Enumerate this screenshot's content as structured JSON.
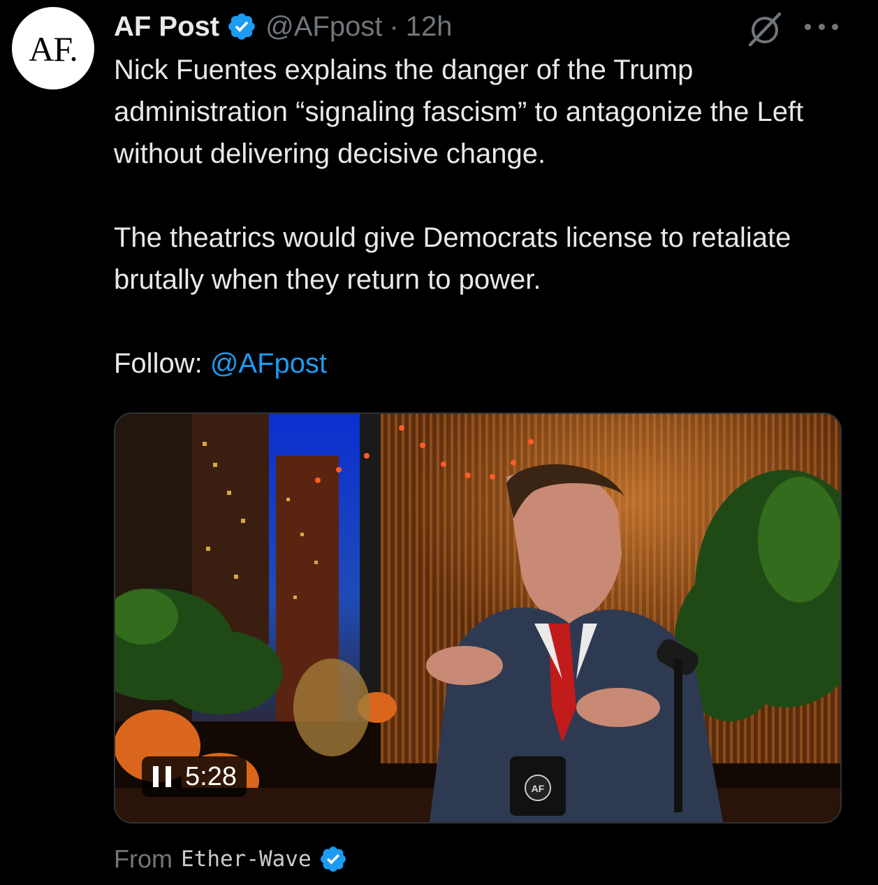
{
  "post": {
    "avatar_text": "AF.",
    "author_name": "AF Post",
    "handle": "@AFpost",
    "separator": "·",
    "time_ago": "12h",
    "paragraph_1": "Nick Fuentes explains the danger of the Trump administration “signaling fascism” to antagonize the Left without delivering decisive change.",
    "paragraph_2": "The theatrics would give Democrats license to retaliate brutally when they return to power.",
    "follow_label": "Follow: ",
    "follow_mention": "@AFpost"
  },
  "video": {
    "duration": "5:28",
    "state_icon": "pause-icon",
    "mug_logo": "AF"
  },
  "source": {
    "prefix": "From",
    "name": "Ether-Wave"
  },
  "icons": {
    "verified": "verified-badge-icon",
    "grok": "grok-icon",
    "more": "more-options-icon"
  },
  "colors": {
    "background": "#000000",
    "text_primary": "#e7e9ea",
    "text_secondary": "#71767b",
    "link": "#1d9bf0",
    "verified": "#1d9bf0"
  }
}
